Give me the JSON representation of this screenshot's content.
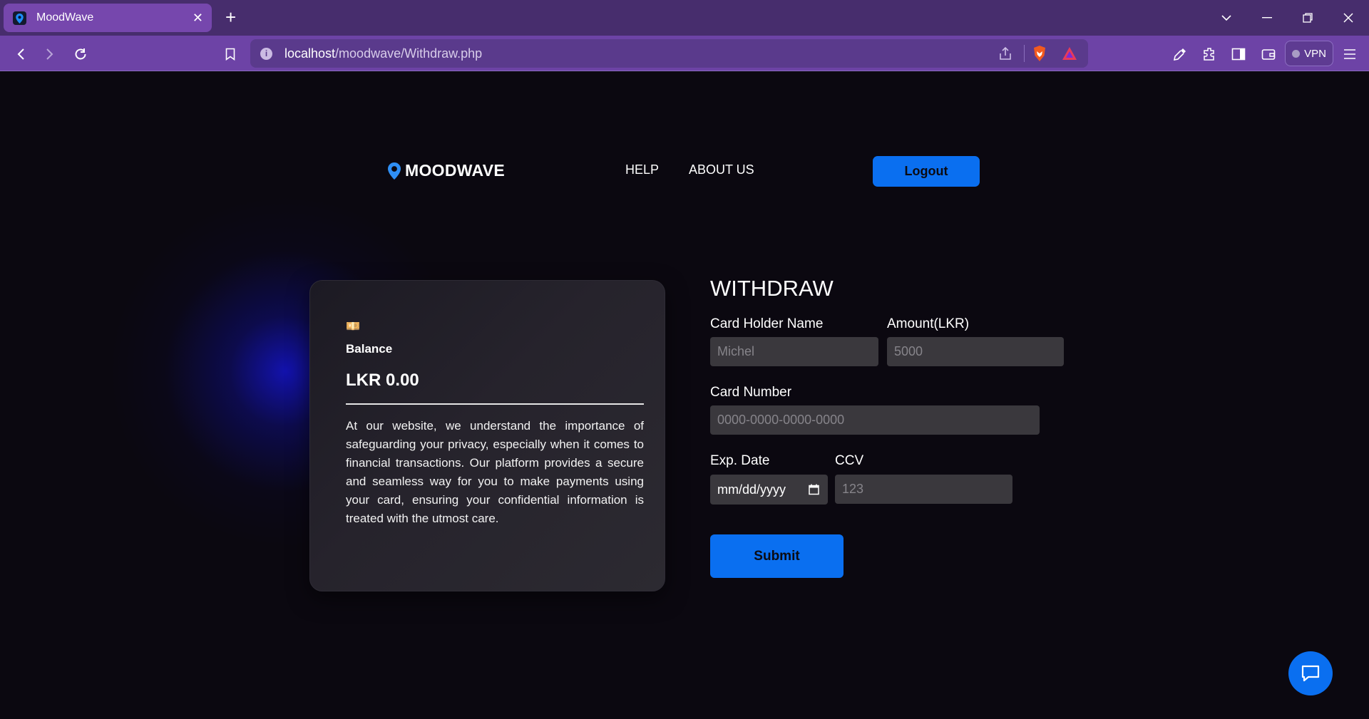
{
  "browser": {
    "tab_title": "MoodWave",
    "tab_close": "✕",
    "new_tab": "+",
    "url_host": "localhost",
    "url_path": "/moodwave/Withdraw.php",
    "vpn_label": "VPN"
  },
  "header": {
    "brand_name": "MOODWAVE",
    "nav": [
      "HELP",
      "ABOUT US"
    ],
    "logout_label": "Logout"
  },
  "card": {
    "icon": "💴",
    "balance_label": "Balance",
    "balance_value": "LKR 0.00",
    "description": "At our website, we understand the importance of safeguarding your privacy, especially when it comes to financial transactions. Our platform provides a secure and seamless way for you to make payments using your card, ensuring your confidential information is treated with the utmost care."
  },
  "form": {
    "title": "WITHDRAW",
    "card_holder_label": "Card Holder Name",
    "card_holder_placeholder": "Michel",
    "amount_label": "Amount(LKR)",
    "amount_placeholder": "5000",
    "card_number_label": "Card Number",
    "card_number_placeholder": "0000-0000-0000-0000",
    "exp_label": "Exp. Date",
    "exp_placeholder": "mm/dd/yyyy",
    "ccv_label": "CCV",
    "ccv_placeholder": "123",
    "submit_label": "Submit"
  },
  "colors": {
    "accent": "#0a6ff0",
    "background": "#0b0810",
    "browser_frame": "#6d43a6"
  }
}
